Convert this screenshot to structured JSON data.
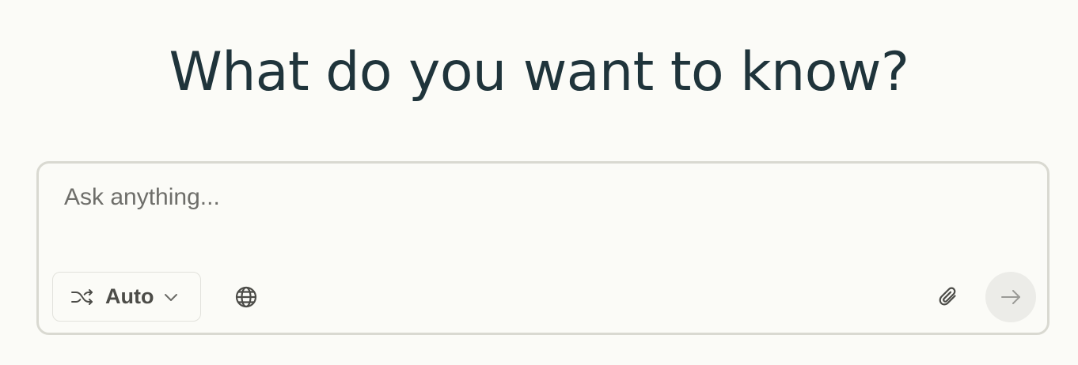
{
  "header": {
    "title": "What do you want to know?"
  },
  "composer": {
    "placeholder": "Ask anything...",
    "value": "",
    "mode": {
      "label": "Auto",
      "icon": "shuffle-icon",
      "dropdown_icon": "chevron-down-icon"
    },
    "buttons": {
      "web_search_icon": "globe-icon",
      "attach_icon": "paperclip-icon",
      "submit_icon": "arrow-right-icon"
    }
  },
  "colors": {
    "background": "#fbfbf7",
    "title_text": "#1f343b",
    "border": "#d9d9d1",
    "icon": "#4c4c48",
    "submit_bg": "#ecece8"
  }
}
